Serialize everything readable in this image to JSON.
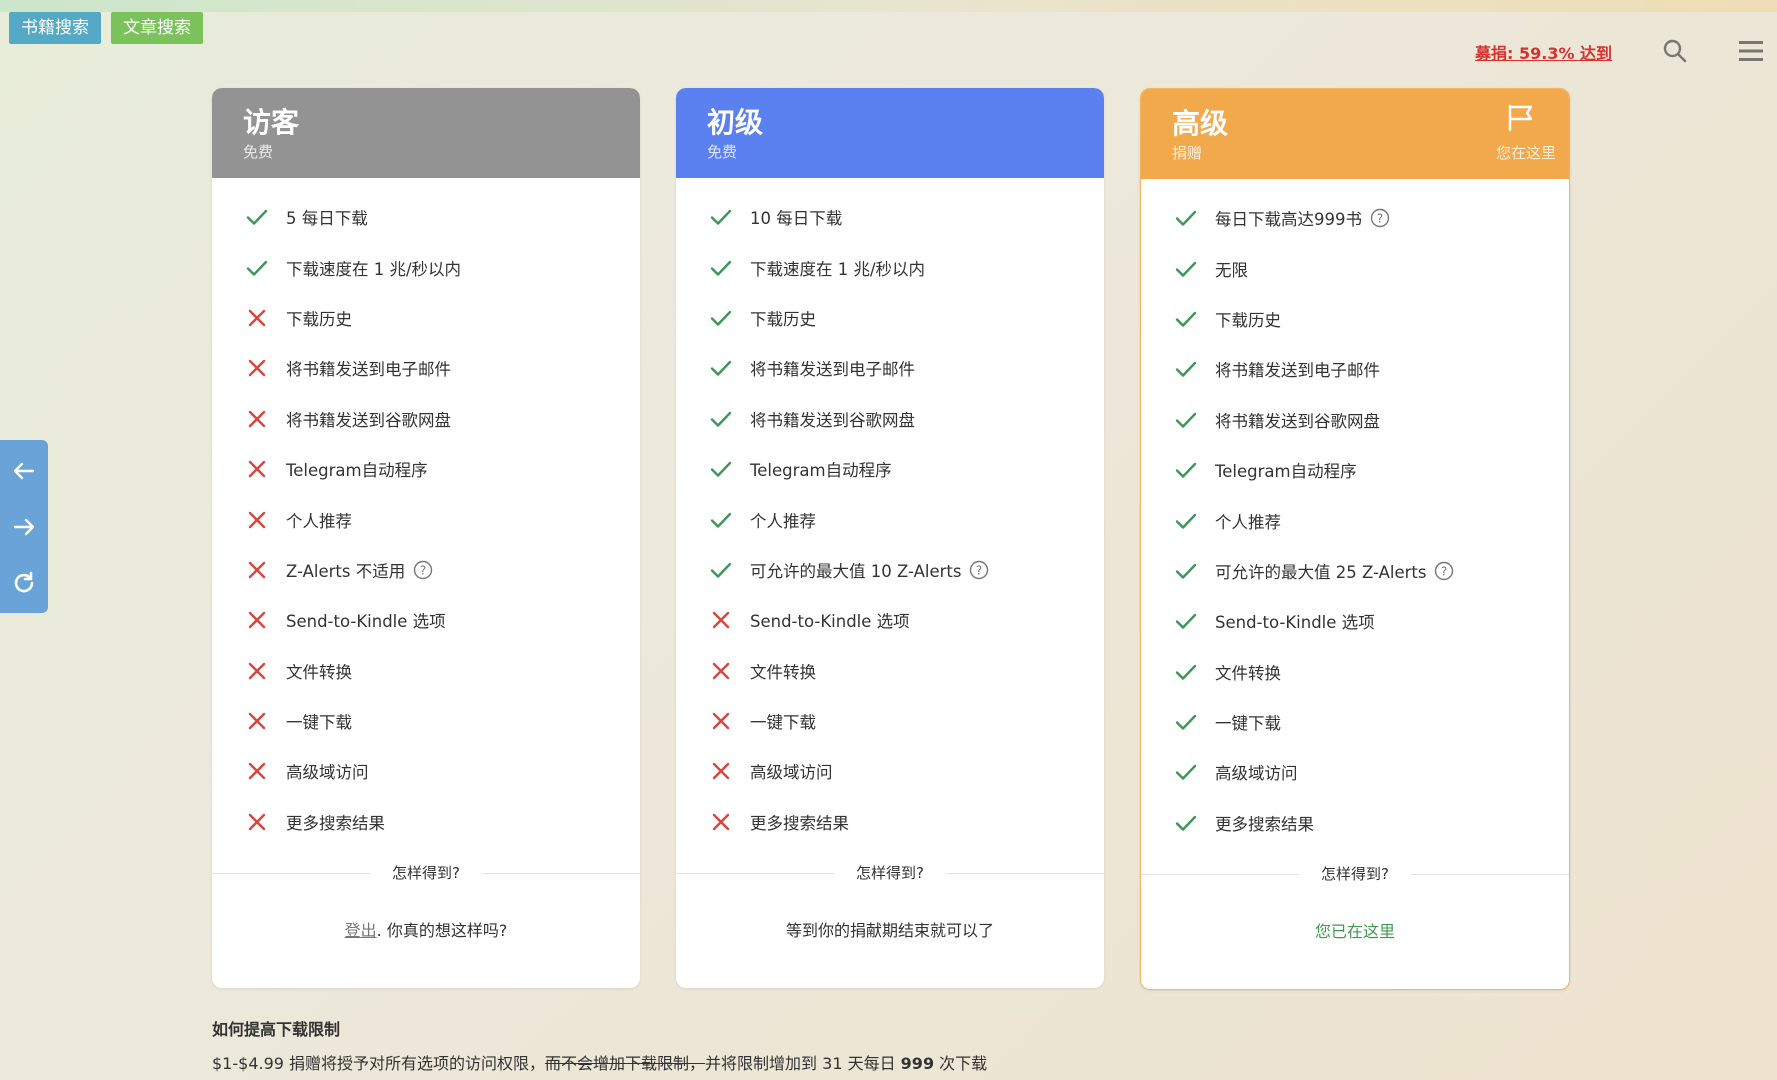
{
  "topbar": {
    "book_search": "书籍搜索",
    "article_search": "文章搜索",
    "donation": "募捐: 59.3% 达到",
    "icons": [
      "search-icon",
      "menu-icon"
    ]
  },
  "sidenav": {
    "icons": [
      "back-arrow-icon",
      "forward-arrow-icon",
      "refresh-icon"
    ]
  },
  "colors": {
    "guest": "#939393",
    "basic": "#5b80f0",
    "premium": "#f2a94c",
    "check": "#3e9659",
    "cross": "#d9453e",
    "donation": "#d6322f"
  },
  "plans": [
    {
      "name": "访客",
      "subtitle": "免费",
      "features": [
        {
          "text": "5 每日下载",
          "ok": true
        },
        {
          "text": "下载速度在 1 兆/秒以内",
          "ok": true
        },
        {
          "text": "下载历史",
          "ok": false
        },
        {
          "text": "将书籍发送到电子邮件",
          "ok": false
        },
        {
          "text": "将书籍发送到谷歌网盘",
          "ok": false
        },
        {
          "text": "Telegram自动程序",
          "ok": false
        },
        {
          "text": "个人推荐",
          "ok": false
        },
        {
          "text": "Z-Alerts 不适用",
          "ok": false,
          "help": true
        },
        {
          "text": "Send-to-Kindle 选项",
          "ok": false
        },
        {
          "text": "文件转换",
          "ok": false
        },
        {
          "text": "一键下载",
          "ok": false
        },
        {
          "text": "高级域访问",
          "ok": false
        },
        {
          "text": "更多搜索结果",
          "ok": false
        }
      ],
      "how": "怎样得到?",
      "footer_link": "登出",
      "footer_text": ". 你真的想这样吗?"
    },
    {
      "name": "初级",
      "subtitle": "免费",
      "features": [
        {
          "text": "10 每日下载",
          "ok": true
        },
        {
          "text": "下载速度在 1 兆/秒以内",
          "ok": true
        },
        {
          "text": "下载历史",
          "ok": true
        },
        {
          "text": "将书籍发送到电子邮件",
          "ok": true
        },
        {
          "text": "将书籍发送到谷歌网盘",
          "ok": true
        },
        {
          "text": "Telegram自动程序",
          "ok": true
        },
        {
          "text": "个人推荐",
          "ok": true
        },
        {
          "text": "可允许的最大值 10 Z-Alerts",
          "ok": true,
          "help": true
        },
        {
          "text": "Send-to-Kindle 选项",
          "ok": false
        },
        {
          "text": "文件转换",
          "ok": false
        },
        {
          "text": "一键下载",
          "ok": false
        },
        {
          "text": "高级域访问",
          "ok": false
        },
        {
          "text": "更多搜索结果",
          "ok": false
        }
      ],
      "how": "怎样得到?",
      "footer_text": "等到你的捐献期结束就可以了"
    },
    {
      "name": "高级",
      "subtitle": "捐赠",
      "current": "您在这里",
      "features": [
        {
          "text": "每日下载高达999书",
          "ok": true,
          "help": true
        },
        {
          "text": "无限",
          "ok": true
        },
        {
          "text": "下载历史",
          "ok": true
        },
        {
          "text": "将书籍发送到电子邮件",
          "ok": true
        },
        {
          "text": "将书籍发送到谷歌网盘",
          "ok": true
        },
        {
          "text": "Telegram自动程序",
          "ok": true
        },
        {
          "text": "个人推荐",
          "ok": true
        },
        {
          "text": "可允许的最大值 25 Z-Alerts",
          "ok": true,
          "help": true
        },
        {
          "text": "Send-to-Kindle 选项",
          "ok": true
        },
        {
          "text": "文件转换",
          "ok": true
        },
        {
          "text": "一键下载",
          "ok": true
        },
        {
          "text": "高级域访问",
          "ok": true
        },
        {
          "text": "更多搜索结果",
          "ok": true
        }
      ],
      "how": "怎样得到?",
      "footer_text": "您已在这里"
    }
  ],
  "bottom": {
    "title": "如何提高下载限制",
    "text_a": "$1-$4.99 捐赠将授予对所有选项的访问权限，",
    "text_strike": "而不会增加下载限制，",
    "text_b": "并将限制增加到 31 天每日 ",
    "text_bold": "999",
    "text_c": " 次下载"
  }
}
